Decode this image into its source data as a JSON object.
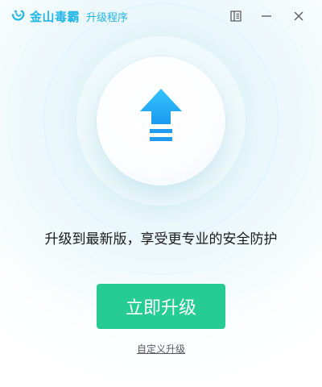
{
  "titlebar": {
    "brand": "金山毒霸",
    "app_name": "升级程序",
    "icons": [
      "logo-swirl-icon",
      "menu-icon",
      "minimize-icon",
      "close-icon"
    ],
    "color_accent": "#23b5e4"
  },
  "hero": {
    "icon": "upload-arrow-icon",
    "icon_color": "#1fa8f0"
  },
  "main": {
    "headline": "升级到最新版，享受更专业的安全防护",
    "primary_button_label": "立即升级",
    "primary_button_color": "#26cc93",
    "custom_link": "自定义升级"
  }
}
